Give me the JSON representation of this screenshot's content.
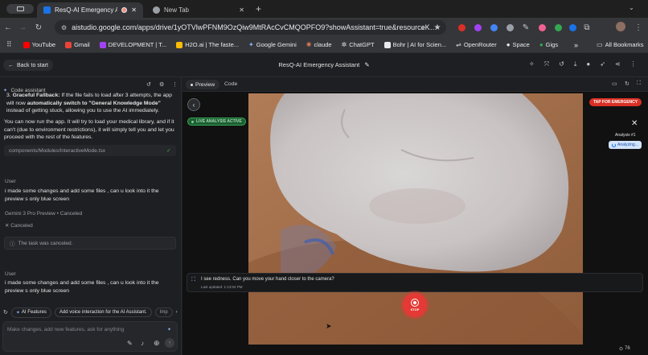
{
  "browser": {
    "tabs": [
      {
        "title": "ResQ-AI Emergency Assis",
        "active": true,
        "recording": true
      },
      {
        "title": "New Tab",
        "active": false
      }
    ],
    "url": "aistudio.google.com/apps/drive/1yOTVlwPFNM9OzQiw9MtRAcCvCMQOPFO9?showAssistant=true&resourceKey=..."
  },
  "bookmarks": [
    {
      "label": "YouTube",
      "color": "#ff0000"
    },
    {
      "label": "Gmail",
      "color": "#ea4335"
    },
    {
      "label": "DEVELOPMENT | T...",
      "color": "#a142f4"
    },
    {
      "label": "H2O.ai | The faste...",
      "color": "#fbbc04"
    },
    {
      "label": "Google Gemini",
      "color": "#8ab4f8"
    },
    {
      "label": "claude",
      "color": "#d97757"
    },
    {
      "label": "ChatGPT",
      "color": "#e3e3e3"
    },
    {
      "label": "Bohr | AI for Scien...",
      "color": "#e3e3e3"
    },
    {
      "label": "OpenRouter",
      "color": "#9aa0a6"
    },
    {
      "label": "Space",
      "color": "#e3e3e3"
    },
    {
      "label": "Gigs",
      "color": "#34a853"
    }
  ],
  "bookmarks_more": "»",
  "all_bookmarks": "All Bookmarks",
  "header": {
    "back_label": "Back to start",
    "title": "ResQ-AI Emergency Assistant"
  },
  "assistant": {
    "label": "Code assistant",
    "fallback_item": {
      "number": "3.",
      "bold_lead": "Graceful Fallback:",
      "text_a": " If the file fails to load after 3 attempts, the app will now ",
      "bold_mid": "automatically switch to \"General Knowledge Mode\"",
      "text_b": " instead of getting stuck, allowing you to use the AI immediately."
    },
    "paragraph": "You can now run the app. It will try to load your medical library, and if it can't (due to environment restrictions), it will simply tell you and let you proceed with the rest of the features.",
    "file_ref": "components/Modules/InteractiveMode.tsx",
    "user_label": "User",
    "user_msg": "i made some changes and add some files , can u look into it the preview s only blue screen",
    "model_label": "Gemini 3 Pro Preview",
    "model_status": "Canceled",
    "canceled": "Canceled",
    "task_canceled": "The task was canceled.",
    "user_label_2": "User",
    "user_msg_2": "i made some changes and add some files , can u look into it the preview s only blue screen",
    "chips": [
      "AI Features",
      "Add voice interaction for the AI Assistant.",
      "Imp"
    ],
    "input_placeholder": "Make changes, add new features, ask for anything"
  },
  "preview": {
    "tabs": [
      "Preview",
      "Code"
    ],
    "live_badge": "LIVE ANALYSIS ACTIVE",
    "emergency_button": "TAP FOR EMERGENCY",
    "analysis_label": "Analysis #1",
    "analyzing": "Analyzing...",
    "caption": "I see redness. Can you move your hand closer to the camera?",
    "updated": "Last updated: 1:13:04 PM",
    "stop_label": "STOP",
    "zoom": "76"
  },
  "colors": {
    "accent_blue": "#8ab4f8",
    "live_green": "#1e8e3e",
    "emergency_red": "#d93025",
    "stop_red": "#e53935"
  }
}
